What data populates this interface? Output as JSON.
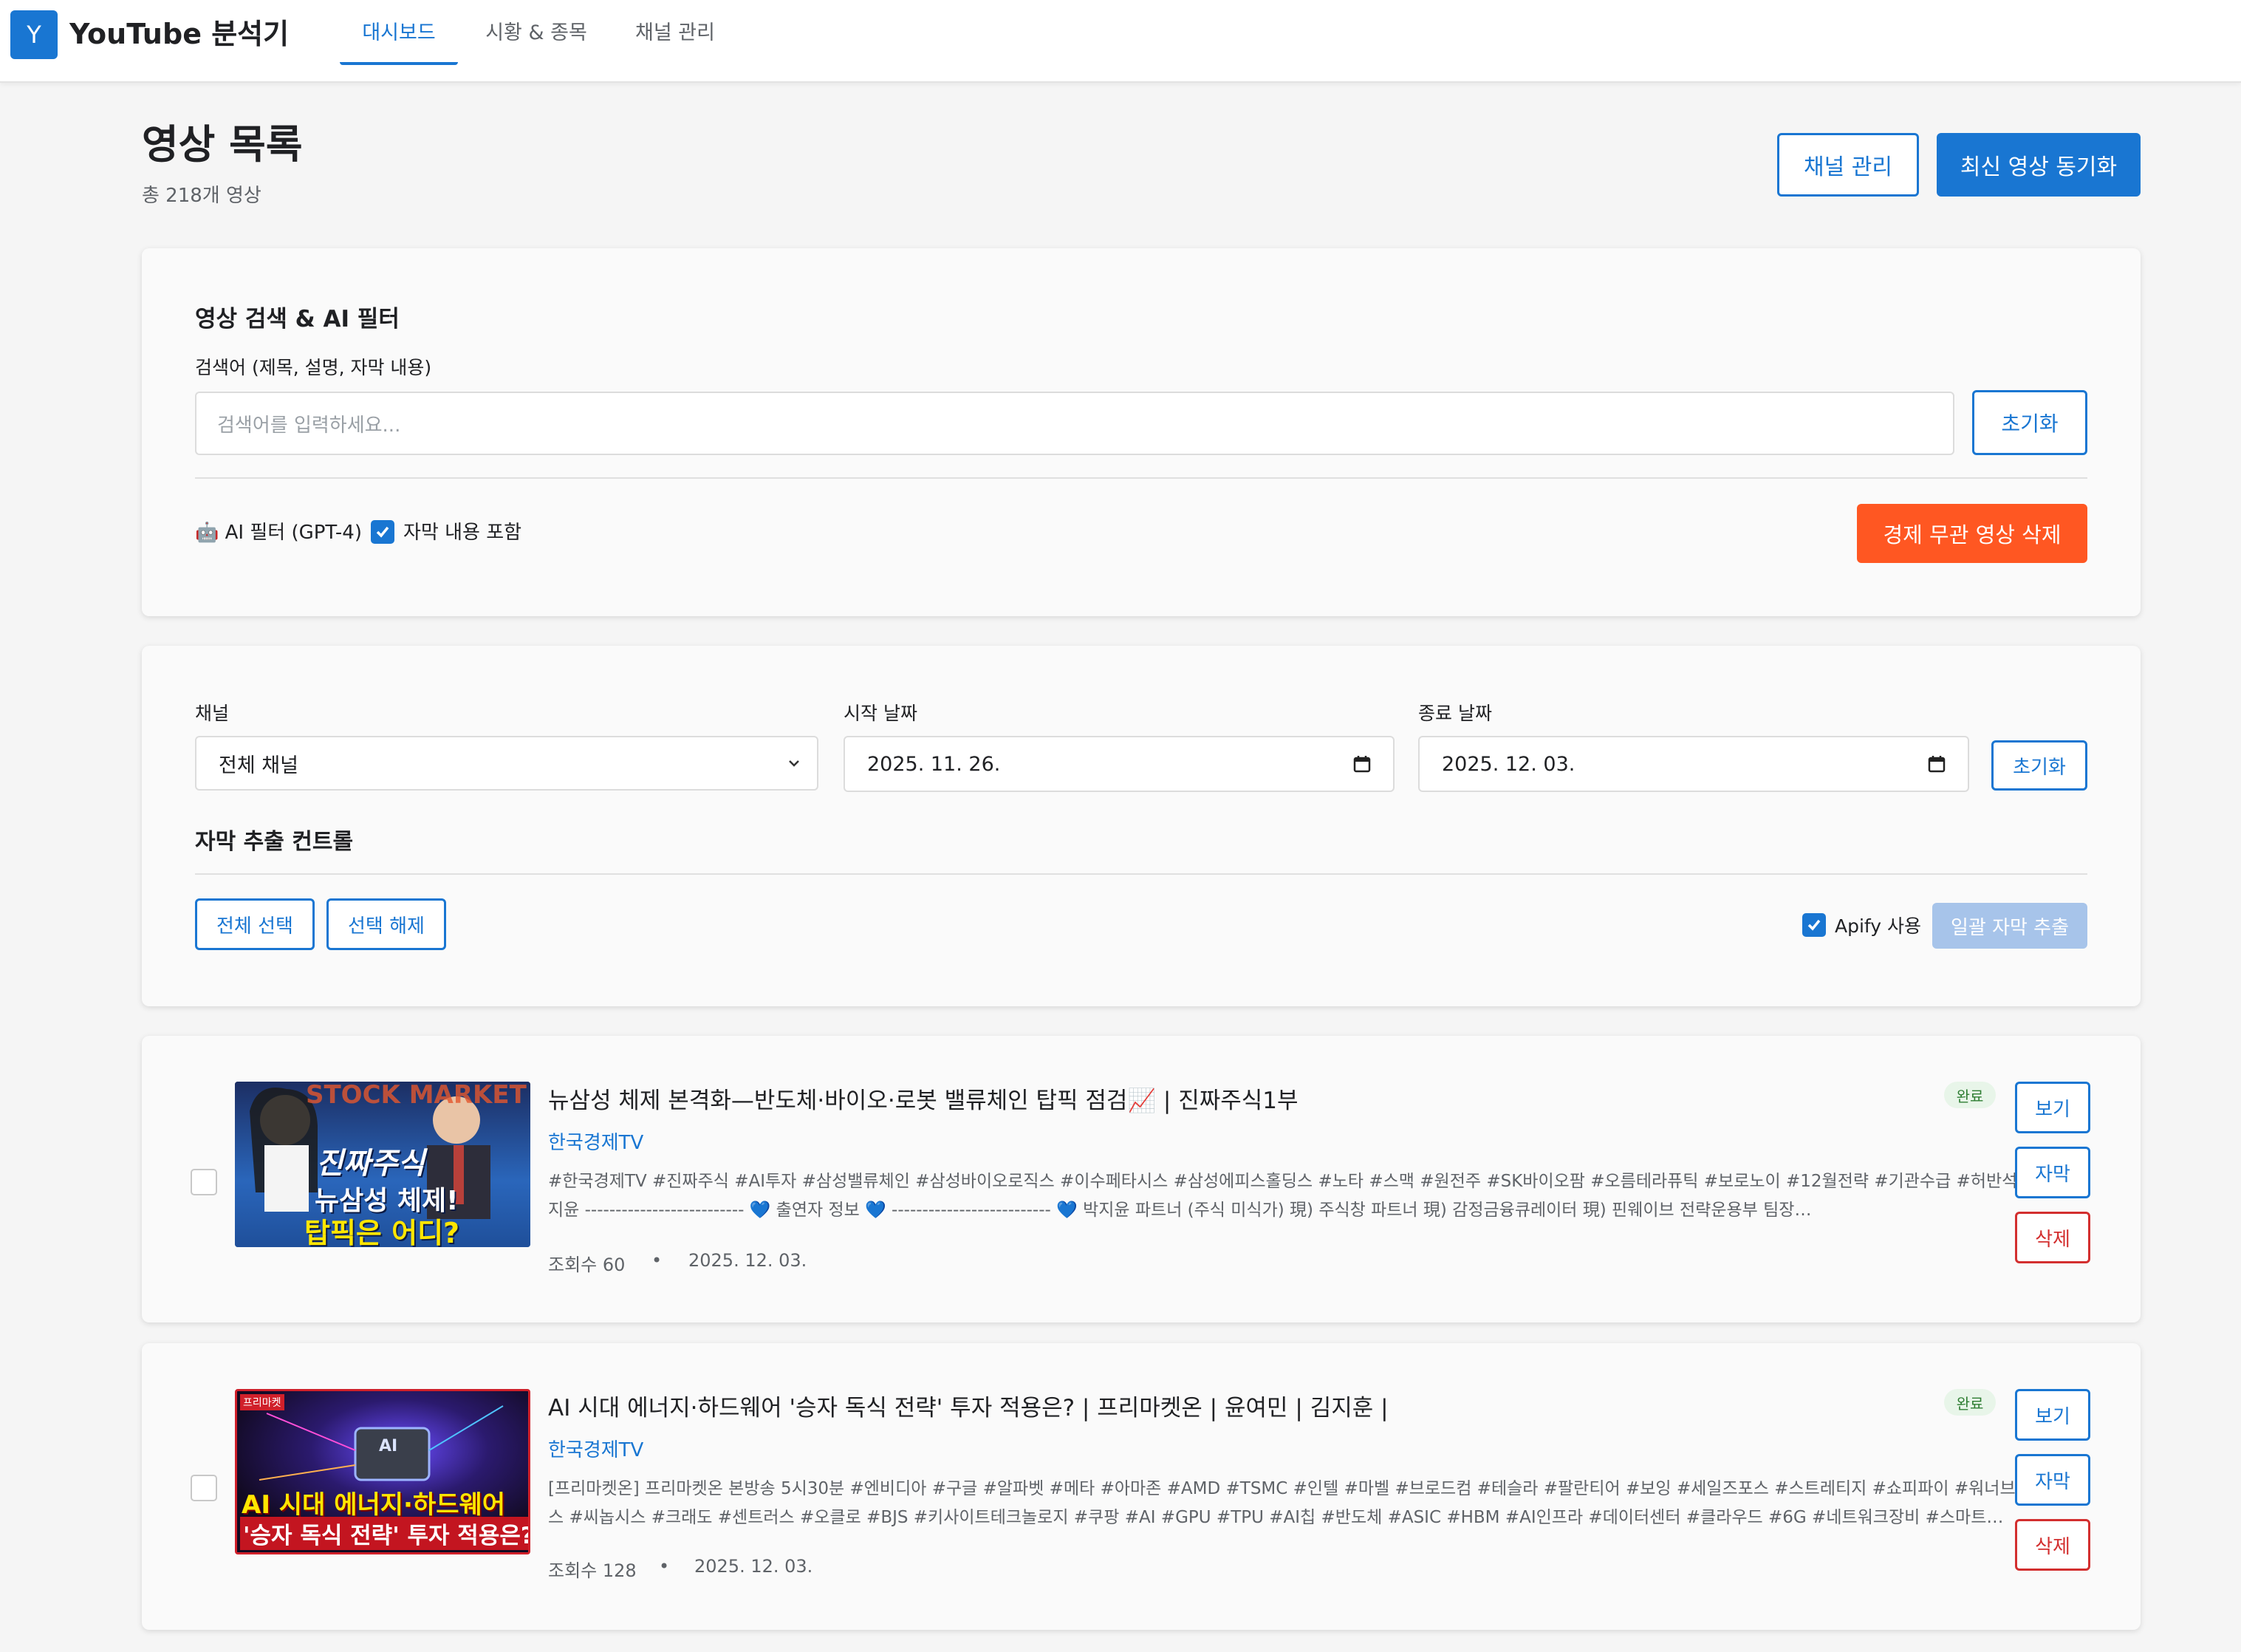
{
  "header": {
    "logo_letter": "Y",
    "app_title": "YouTube 분석기",
    "tabs": [
      {
        "label": "대시보드"
      },
      {
        "label": "시황 & 종목"
      },
      {
        "label": "채널 관리"
      }
    ]
  },
  "page": {
    "title": "영상 목록",
    "subtitle": "총 218개 영상",
    "channel_manage_label": "채널 관리",
    "sync_label": "최신 영상 동기화"
  },
  "search_card": {
    "title": "영상 검색 & AI 필터",
    "search_label": "검색어 (제목, 설명, 자막 내용)",
    "search_placeholder": "검색어를 입력하세요...",
    "reset_label": "초기화",
    "ai_filter_label": "🤖 AI 필터 (GPT-4)",
    "include_subtitles_label": "자막 내용 포함",
    "delete_unrelated_label": "경제 무관 영상 삭제"
  },
  "filter_card": {
    "channel_label": "채널",
    "channel_value": "전체 채널",
    "start_date_label": "시작 날짜",
    "start_date_value": "2025. 11. 26.",
    "end_date_label": "종료 날짜",
    "end_date_value": "2025. 12. 03.",
    "reset_label": "초기화",
    "subtitle_control_title": "자막 추출 컨트롤",
    "select_all_label": "전체 선택",
    "deselect_label": "선택 해제",
    "apify_label": "Apify 사용",
    "batch_extract_label": "일괄 자막 추출"
  },
  "videos": [
    {
      "title": "뉴삼성 체제 본격화—반도체·바이오·로봇 밸류체인 탑픽 점검📈 | 진짜주식1부",
      "channel": "한국경제TV",
      "description": "#한국경제TV #진짜주식 #AI투자 #삼성밸류체인 #삼성바이오로직스 #이수페타시스 #삼성에피스홀딩스 #노타 #스맥 #원전주 #SK바이오팜 #오름테라퓨틱 #보로노이 #12월전략 #기관수급 #허반석 #박지윤 -------------------------- 💙 출연자 정보 💙 -------------------------- 💙 박지윤 파트너 (주식 미식가) 現) 주식창 파트너 現) 감정금융큐레이터 現) 핀웨이브 전략운용부 팀장…",
      "views": "조회수 60",
      "date": "2025. 12. 03.",
      "status": "완료",
      "thumb_text_1": "진짜주식",
      "thumb_text_2": "뉴삼성 체제!",
      "thumb_text_3": "탑픽은 어디?",
      "thumb_text_bg": "STOCK MARKET",
      "view_label": "보기",
      "subtitle_label": "자막",
      "delete_label": "삭제"
    },
    {
      "title": "AI 시대 에너지·하드웨어 '승자 독식 전략' 투자 적용은? | 프리마켓온 | 윤여민 | 김지훈 |",
      "channel": "한국경제TV",
      "description": "[프리마켓온] 프리마켓온 본방송 5시30분 #엔비디아 #구글 #알파벳 #메타 #아마존 #AMD #TSMC #인텔 #마벨 #브로드컴 #테슬라 #팔란티어 #보잉 #세일즈포스 #스트레티지 #쇼피파이 #워너브라더스 #씨놉시스 #크래도 #센트러스 #오클로 #BJS #키사이트테크놀로지 #쿠팡 #AI #GPU #TPU #AI칩 #반도체 #ASIC #HBM #AI인프라 #데이터센터 #클라우드 #6G #네트워크장비 #스마트…",
      "views": "조회수 128",
      "date": "2025. 12. 03.",
      "status": "완료",
      "thumb_text_1": "AI 시대 에너지·하드웨어",
      "thumb_text_2": "'승자 독식 전략' 투자 적용은?",
      "thumb_badge": "프리마켓",
      "thumb_chip": "AI",
      "view_label": "보기",
      "subtitle_label": "자막",
      "delete_label": "삭제"
    }
  ],
  "colors": {
    "primary": "#1976d2",
    "danger": "#d32f2f",
    "warning": "#ff5722",
    "success_badge": "#2e7d32"
  }
}
